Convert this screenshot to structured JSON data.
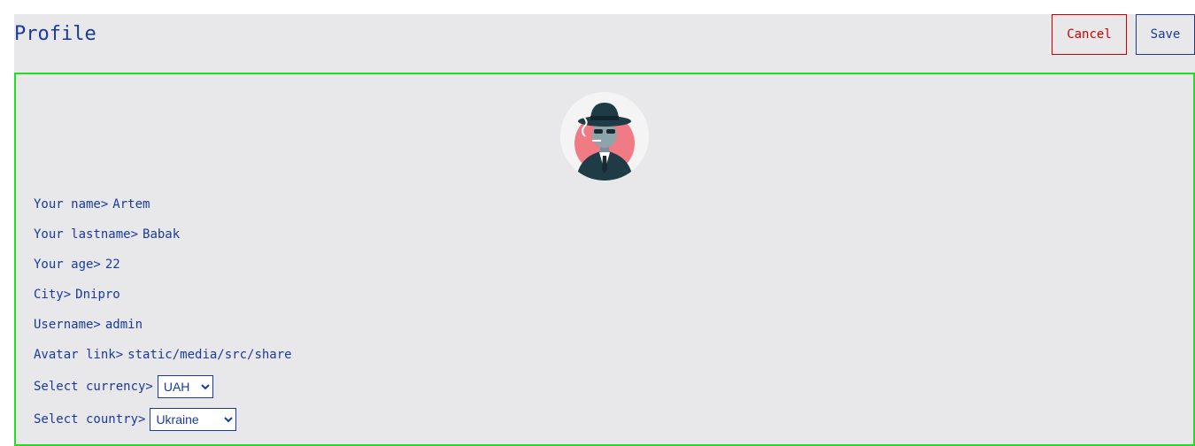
{
  "header": {
    "title": "Profile",
    "cancel_label": "Cancel",
    "save_label": "Save"
  },
  "profile": {
    "avatar_icon": "detective-avatar-icon",
    "fields": {
      "name": {
        "label": "Your name>",
        "value": "Artem"
      },
      "lastname": {
        "label": "Your lastname>",
        "value": "Babak"
      },
      "age": {
        "label": "Your age>",
        "value": "22"
      },
      "city": {
        "label": "City>",
        "value": "Dnipro"
      },
      "username": {
        "label": "Username>",
        "value": "admin"
      },
      "avatar_link": {
        "label": "Avatar link>",
        "value": "static/media/src/share"
      },
      "currency": {
        "label": "Select currency>",
        "value": "UAH"
      },
      "country": {
        "label": "Select country>",
        "value": "Ukraine"
      }
    }
  },
  "colors": {
    "text": "#1a3a9c",
    "cancel": "#cc0000",
    "panel_border": "#22dd22",
    "background": "#e8e8ea"
  }
}
